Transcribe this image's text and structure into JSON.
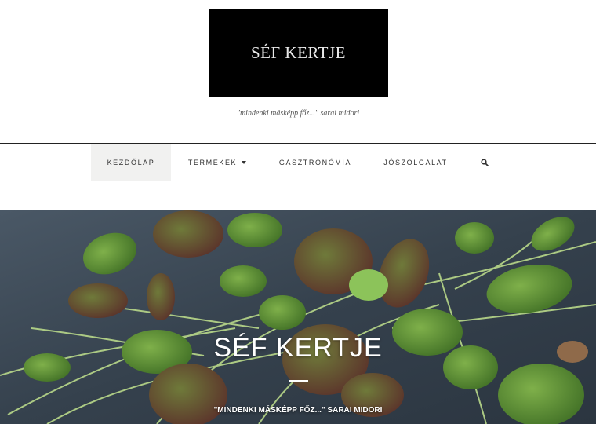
{
  "header": {
    "logo_text": "SÉF KERTJE",
    "tagline": "\"mindenki másképp főz...\" sarai midori"
  },
  "nav": {
    "items": [
      {
        "label": "KEZDŐLAP",
        "active": true
      },
      {
        "label": "TERMÉKEK",
        "has_dropdown": true
      },
      {
        "label": "GASZTRONÓMIA"
      },
      {
        "label": "JÓSZOLGÁLAT"
      }
    ],
    "search_icon": "search-icon"
  },
  "hero": {
    "title": "SÉF KERTJE",
    "tagline": "\"MINDENKI MÁSKÉPP FŐZ...\" SARAI MIDORI",
    "image": "microgreens-on-slate"
  },
  "colors": {
    "logo_background": "#000000",
    "nav_border": "#222222",
    "active_tab_background": "#f1f1f0",
    "hero_slate": "#3a4754",
    "leaf_green": "#4f8a34",
    "leaf_purple": "#6b3a3a"
  }
}
